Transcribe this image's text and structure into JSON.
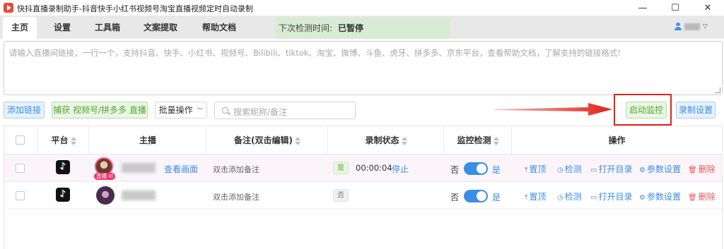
{
  "window": {
    "title": "快抖直播录制助手-抖音快手小红书视频号淘宝直播视频定时自动录制",
    "controls": {
      "minimize": "—",
      "maximize": "☐",
      "close": "✕"
    }
  },
  "nav": {
    "tabs": [
      {
        "label": "主页",
        "active": true
      },
      {
        "label": "设置"
      },
      {
        "label": "工具箱"
      },
      {
        "label": "文案提取"
      },
      {
        "label": "帮助文档"
      }
    ],
    "next_check_label": "下次检测时间:",
    "next_check_value": "已暂停"
  },
  "links_input": {
    "placeholder": "请输入直播间链接，一行一个，支持抖音、快手、小红书、视频号、Bilibili、tiktok、淘宝、微博、斗鱼、虎牙、拼多多、京东平台，查看帮助文档，了解支持的链接格式!"
  },
  "toolbar": {
    "add_link": "添加链接",
    "capture": "捕获 视频号/拼多多 直播",
    "batch": "批量操作",
    "search_placeholder": "搜索昵称/备注",
    "start_monitor": "启动监控",
    "record_settings": "录制设置"
  },
  "colors": {
    "accent": "#3a8ee6",
    "success": "#55a532",
    "danger": "#e35b5b",
    "highlight": "#e0221b"
  },
  "table": {
    "headers": {
      "platform": "平台",
      "streamer": "主播",
      "note": "备注(双击编辑)",
      "status": "录制状态",
      "monitor": "监控检测",
      "actions": "操作"
    },
    "rows": [
      {
        "platform_icon": "tiktok-icon",
        "live_badge": "直播 ııl",
        "view_link": "查看画面",
        "note": "双击添加备注",
        "status_tag": "是",
        "duration": "00:00:04",
        "stop": "停止",
        "monitor_off": "否",
        "monitor_on": "是",
        "actions": {
          "top": "置顶",
          "check": "检测",
          "open_dir": "打开目录",
          "params": "参数设置",
          "delete": "删除"
        }
      },
      {
        "platform_icon": "tiktok-icon",
        "note": "双击添加备注",
        "status_tag": "否",
        "monitor_off": "否",
        "monitor_on": "是",
        "actions": {
          "top": "置顶",
          "check": "检测",
          "open_dir": "打开目录",
          "params": "参数设置",
          "delete": "删除"
        }
      }
    ]
  }
}
